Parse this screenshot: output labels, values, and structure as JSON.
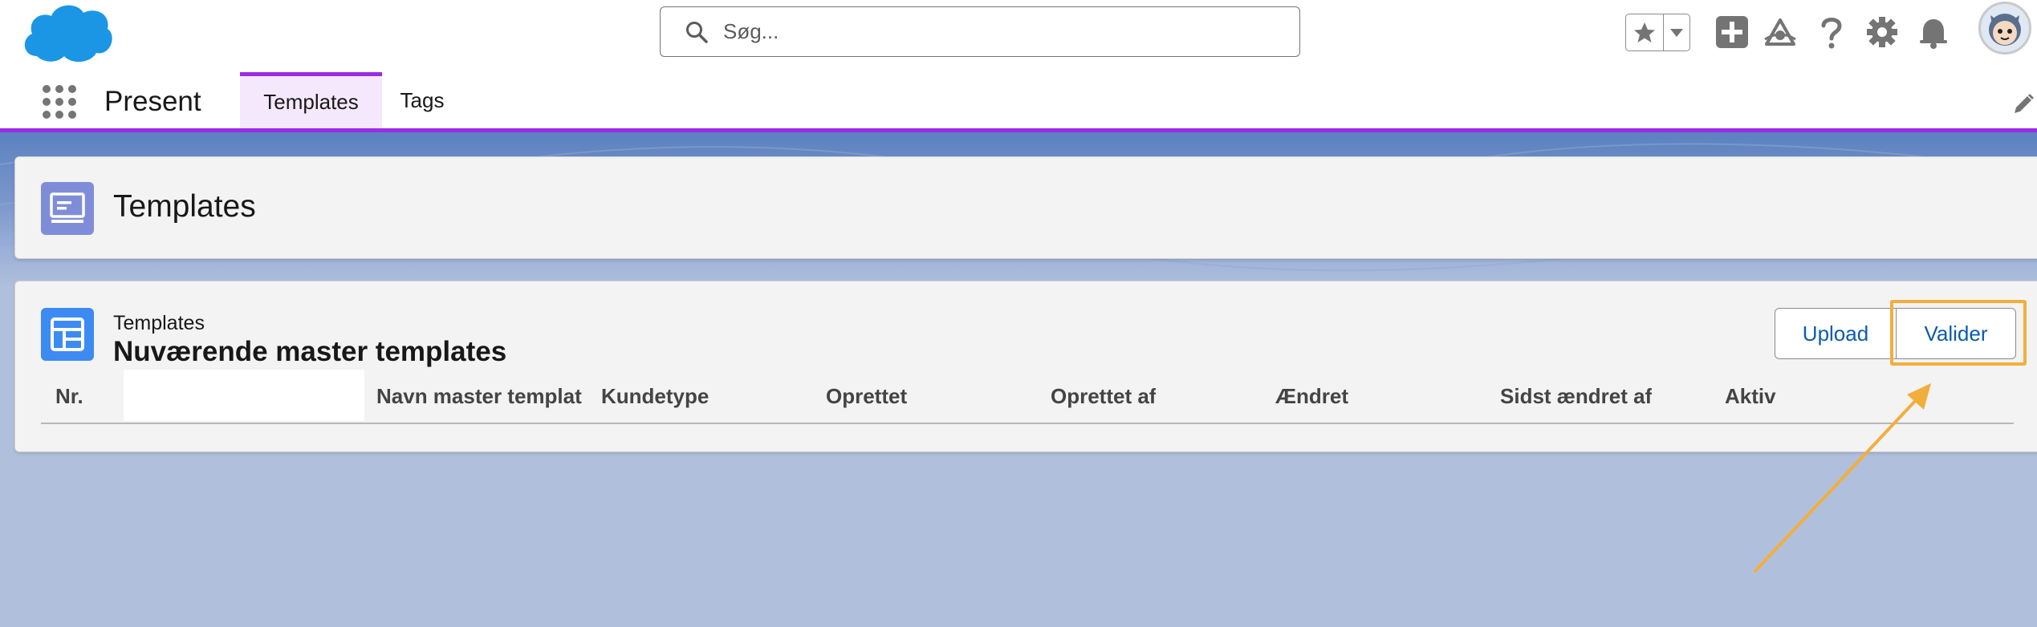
{
  "header": {
    "search_placeholder": "Søg...",
    "icons": [
      "salesforce-cloud-logo",
      "search-icon",
      "star-icon",
      "chevron-down-icon",
      "plus-icon",
      "trailhead-icon",
      "help-icon",
      "gear-icon",
      "bell-icon",
      "avatar"
    ]
  },
  "nav": {
    "app_name": "Present",
    "tabs": [
      {
        "label": "Templates",
        "active": true
      },
      {
        "label": "Tags",
        "active": false
      }
    ]
  },
  "page_header": {
    "title": "Templates"
  },
  "list_card": {
    "object_label": "Templates",
    "title": "Nuværende master templates",
    "buttons": {
      "upload": "Upload",
      "valider": "Valider"
    },
    "columns": [
      "Nr.",
      "",
      "Navn master templat",
      "Kundetype",
      "Oprettet",
      "Oprettet af",
      "Ændret",
      "Sidst ændret af",
      "Aktiv"
    ]
  },
  "colors": {
    "accent": "#9b2ce6",
    "brand_blue": "#0b5cab",
    "annotation": "#f2ae3d"
  }
}
